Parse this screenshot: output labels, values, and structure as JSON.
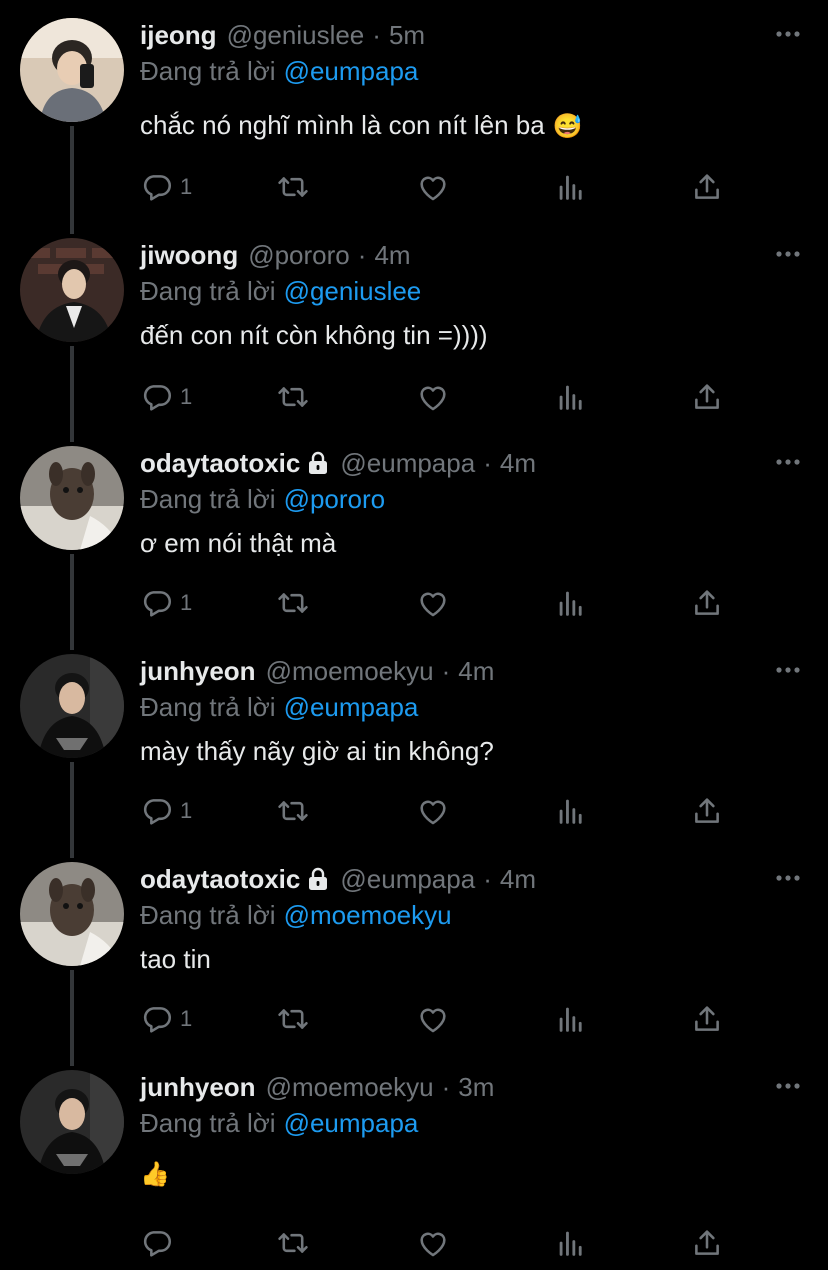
{
  "reply_prefix": "Đang trả lời",
  "tweets": [
    {
      "name": "ijeong",
      "handle": "@geniuslee",
      "time": "5m",
      "protected": false,
      "reply_to": "@eumpapa",
      "text": "chắc nó nghĩ mình là con nít lên ba",
      "emoji": "😅",
      "reply_count": "1",
      "avatar_icon": "avatar-photo"
    },
    {
      "name": "jiwoong",
      "handle": "@pororo",
      "time": "4m",
      "protected": false,
      "reply_to": "@geniuslee",
      "text": "đến con nít còn không tin =))))",
      "emoji": "",
      "reply_count": "1",
      "avatar_icon": "avatar-photo"
    },
    {
      "name": "odaytaotoxic",
      "handle": "@eumpapa",
      "time": "4m",
      "protected": true,
      "reply_to": "@pororo",
      "text": "ơ em nói thật mà",
      "emoji": "",
      "reply_count": "1",
      "avatar_icon": "avatar-photo"
    },
    {
      "name": "junhyeon",
      "handle": "@moemoekyu",
      "time": "4m",
      "protected": false,
      "reply_to": "@eumpapa",
      "text": "mày thấy nãy giờ ai tin không?",
      "emoji": "",
      "reply_count": "1",
      "avatar_icon": "avatar-photo"
    },
    {
      "name": "odaytaotoxic",
      "handle": "@eumpapa",
      "time": "4m",
      "protected": true,
      "reply_to": "@moemoekyu",
      "text": "tao tin",
      "emoji": "",
      "reply_count": "1",
      "avatar_icon": "avatar-photo"
    },
    {
      "name": "junhyeon",
      "handle": "@moemoekyu",
      "time": "3m",
      "protected": false,
      "reply_to": "@eumpapa",
      "text": "",
      "emoji": "👍",
      "reply_count": "",
      "avatar_icon": "avatar-photo"
    }
  ],
  "colors": {
    "background": "#000000",
    "text": "#e7e9ea",
    "muted": "#71767b",
    "link": "#1d9bf0",
    "thread_line": "#333639"
  },
  "icons": [
    "more-icon",
    "lock-icon",
    "reply-icon",
    "retweet-icon",
    "like-icon",
    "analytics-icon",
    "share-icon"
  ]
}
